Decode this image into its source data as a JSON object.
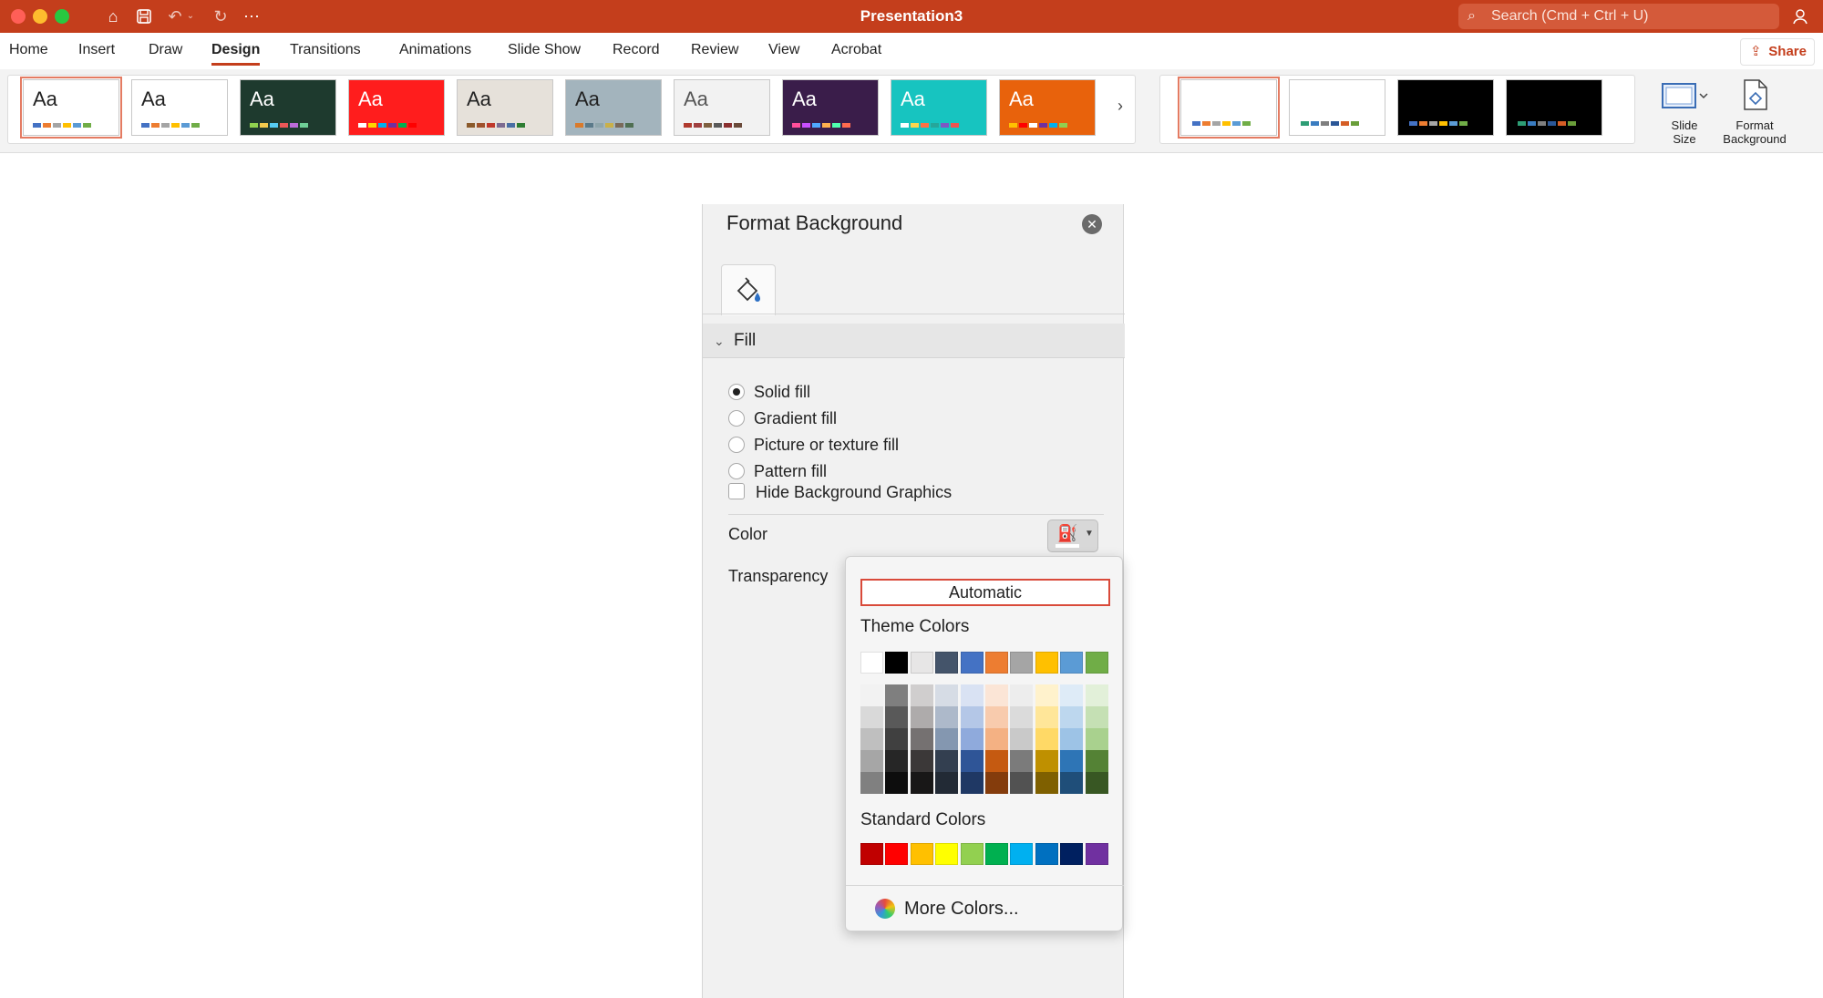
{
  "app": {
    "title": "Presentation3",
    "search_placeholder": "Search (Cmd + Ctrl + U)",
    "share_label": "Share",
    "toolbar_icons": [
      "home-icon",
      "save-icon",
      "undo-icon",
      "chevron-down-icon",
      "redo-icon",
      "more-icon"
    ]
  },
  "ribbon_tabs": [
    "Home",
    "Insert",
    "Draw",
    "Design",
    "Transitions",
    "Animations",
    "Slide Show",
    "Record",
    "Review",
    "View",
    "Acrobat"
  ],
  "active_tab": "Design",
  "themes": [
    {
      "aa": "Aa",
      "bg": "#ffffff",
      "fg": "#222222",
      "bars": [
        "#4472c4",
        "#ed7d31",
        "#a5a5a5",
        "#ffc000",
        "#5b9bd5",
        "#70ad47"
      ]
    },
    {
      "aa": "Aa",
      "bg": "#ffffff",
      "fg": "#222222",
      "bars": [
        "#4472c4",
        "#ed7d31",
        "#a5a5a5",
        "#ffc000",
        "#5b9bd5",
        "#70ad47"
      ]
    },
    {
      "aa": "Aa",
      "bg": "#1e3a2e",
      "fg": "#ffffff",
      "bars": [
        "#8fd14f",
        "#f2c94c",
        "#56ccf2",
        "#eb5757",
        "#bb6bd9",
        "#6fcf97"
      ]
    },
    {
      "aa": "Aa",
      "bg": "#ff1d1d",
      "fg": "#ffffff",
      "bars": [
        "#ffffff",
        "#ffd600",
        "#00b0f0",
        "#7030a0",
        "#00b050",
        "#ff0000"
      ]
    },
    {
      "aa": "Aa",
      "bg": "#e6e1da",
      "fg": "#222222",
      "bars": [
        "#8b5a2b",
        "#a0522d",
        "#c0392b",
        "#7d6b91",
        "#4a6fa5",
        "#2e7d32"
      ]
    },
    {
      "aa": "Aa",
      "bg": "#a3b4bd",
      "fg": "#222222",
      "bars": [
        "#d97a2b",
        "#5b7a8a",
        "#8fa6ac",
        "#c9b04a",
        "#7a6a5a",
        "#4f6f52"
      ]
    },
    {
      "aa": "Aa",
      "bg": "#f2f2f2",
      "fg": "#555555",
      "bars": [
        "#b03a2e",
        "#a04040",
        "#7f6040",
        "#5a5a5a",
        "#8a3030",
        "#6a4a3a"
      ]
    },
    {
      "aa": "Aa",
      "bg": "#3a1d4a",
      "fg": "#ffffff",
      "bars": [
        "#ff4f9a",
        "#c94fff",
        "#4fa8ff",
        "#ffb04f",
        "#4fffb0",
        "#ff6b4f"
      ]
    },
    {
      "aa": "Aa",
      "bg": "#17c4c0",
      "fg": "#ffffff",
      "bars": [
        "#ffffff",
        "#ffd54f",
        "#ff7043",
        "#26a69a",
        "#7e57c2",
        "#ef5350"
      ]
    },
    {
      "aa": "Aa",
      "bg": "#e8620c",
      "fg": "#ffffff",
      "bars": [
        "#ffc000",
        "#ff0000",
        "#ffffff",
        "#7030a0",
        "#00b0f0",
        "#92d050"
      ]
    }
  ],
  "variants": [
    {
      "bg": "#ffffff",
      "bars": [
        "#4472c4",
        "#ed7d31",
        "#a5a5a5",
        "#ffc000",
        "#5b9bd5",
        "#70ad47"
      ]
    },
    {
      "bg": "#ffffff",
      "bars": [
        "#2e9d75",
        "#3a7cc0",
        "#7f7f7f",
        "#2b5797",
        "#d55e26",
        "#6a9e3a"
      ]
    },
    {
      "bg": "#000000",
      "bars": [
        "#4472c4",
        "#ed7d31",
        "#a5a5a5",
        "#ffc000",
        "#5b9bd5",
        "#70ad47"
      ]
    },
    {
      "bg": "#000000",
      "bars": [
        "#2e9d75",
        "#3a7cc0",
        "#7f7f7f",
        "#2b5797",
        "#d55e26",
        "#6a9e3a"
      ]
    }
  ],
  "ribbon_buttons": {
    "slide_size_line1": "Slide",
    "slide_size_line2": "Size",
    "format_bg_line1": "Format",
    "format_bg_line2": "Background"
  },
  "panel": {
    "title": "Format Background",
    "section": "Fill",
    "fill_options": [
      {
        "label": "Solid fill",
        "selected": true
      },
      {
        "label": "Gradient fill",
        "selected": false
      },
      {
        "label": "Picture or texture fill",
        "selected": false
      },
      {
        "label": "Pattern fill",
        "selected": false
      }
    ],
    "hide_bg_label": "Hide Background Graphics",
    "hide_bg_checked": false,
    "color_label": "Color",
    "transparency_label": "Transparency"
  },
  "color_popup": {
    "automatic_label": "Automatic",
    "theme_colors_label": "Theme Colors",
    "standard_colors_label": "Standard Colors",
    "more_colors_label": "More Colors...",
    "theme_row": [
      "#ffffff",
      "#000000",
      "#e7e6e6",
      "#44546a",
      "#4472c4",
      "#ed7d31",
      "#a5a5a5",
      "#ffc000",
      "#5b9bd5",
      "#70ad47"
    ],
    "theme_shades": [
      [
        "#f2f2f2",
        "#7f7f7f",
        "#d0cece",
        "#d6dce5",
        "#d9e2f3",
        "#fbe5d6",
        "#ededed",
        "#fff2cc",
        "#deebf7",
        "#e2f0d9"
      ],
      [
        "#d9d9d9",
        "#595959",
        "#aeabab",
        "#adb9ca",
        "#b4c7e7",
        "#f8cbad",
        "#dbdbdb",
        "#ffe699",
        "#bdd7ee",
        "#c5e0b4"
      ],
      [
        "#bfbfbf",
        "#404040",
        "#757171",
        "#8497b0",
        "#8faadc",
        "#f4b183",
        "#c9c9c9",
        "#ffd966",
        "#9dc3e6",
        "#a9d18e"
      ],
      [
        "#a6a6a6",
        "#262626",
        "#3b3838",
        "#333f50",
        "#2f5597",
        "#c55a11",
        "#7b7b7b",
        "#bf9000",
        "#2e75b6",
        "#548235"
      ],
      [
        "#808080",
        "#0d0d0d",
        "#181717",
        "#222a35",
        "#1f3864",
        "#843c0c",
        "#525252",
        "#7f6000",
        "#1f4e79",
        "#385723"
      ]
    ],
    "standard_row": [
      "#c00000",
      "#ff0000",
      "#ffc000",
      "#ffff00",
      "#92d050",
      "#00b050",
      "#00b0f0",
      "#0070c0",
      "#002060",
      "#7030a0"
    ]
  }
}
